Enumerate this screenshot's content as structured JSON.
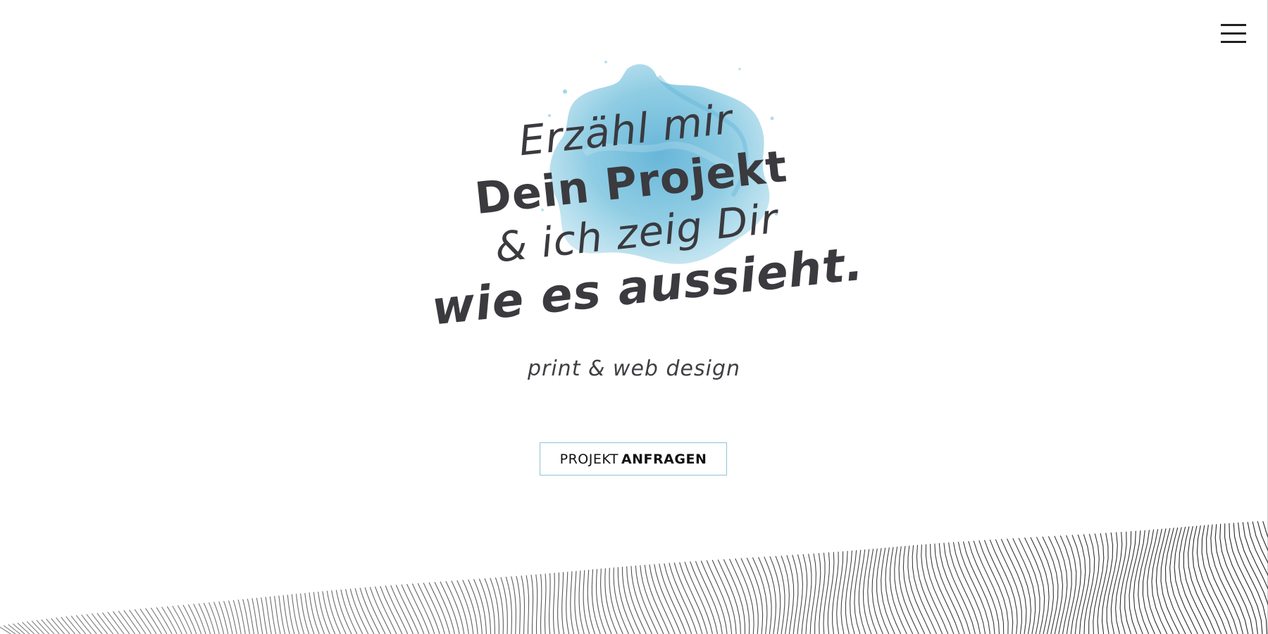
{
  "menu": {
    "icon": "hamburger-menu-icon"
  },
  "hero": {
    "headline": {
      "line1": "Erzähl mir",
      "line2": "Dein Projekt",
      "line3": "& ich zeig Dir",
      "line4": "wie es aussieht."
    },
    "tagline": "print & web design",
    "blob_color": "#6fbcd9"
  },
  "cta": {
    "label_light": "PROJEKT",
    "label_bold": "ANFRAGEN",
    "border_color": "#8cc5d6"
  },
  "decor": {
    "pattern": "wave-lines-pattern",
    "line_color": "#1a1a1a"
  }
}
